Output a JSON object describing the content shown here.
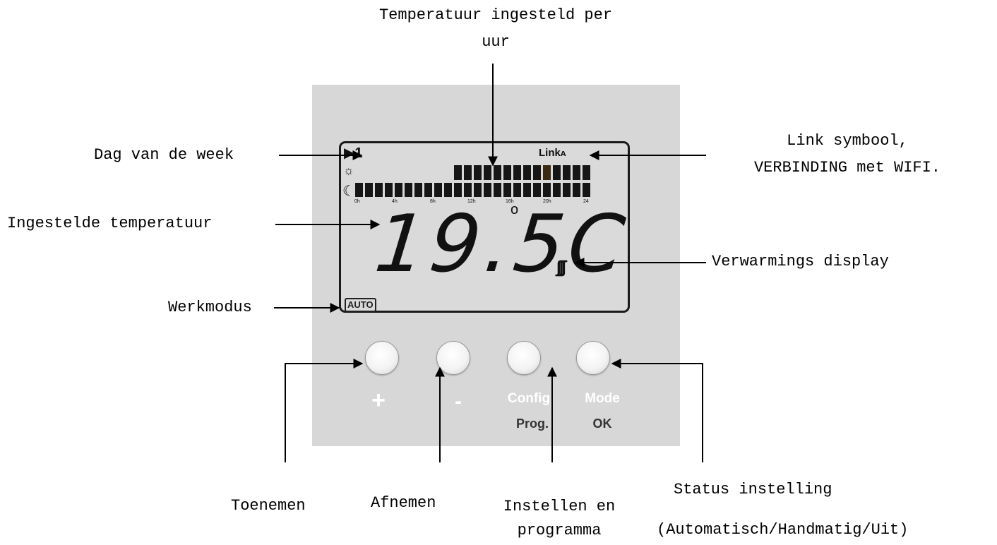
{
  "labels": {
    "top": [
      "Temperatuur ingesteld per",
      "uur"
    ],
    "day_of_week": "Dag van de week",
    "set_temperature": "Ingestelde temperatuur",
    "work_mode": "Werkmodus",
    "link_symbol": [
      "Link symbool,",
      "VERBINDING met WIFI."
    ],
    "heating_display": "Verwarmings display",
    "increase": "Toenemen",
    "decrease": "Afnemen",
    "setup_program": [
      "Instellen en",
      "programma"
    ],
    "status_setting": "Status instelling",
    "status_modes": "(Automatisch/Handmatig/Uit)"
  },
  "display": {
    "day": "1",
    "link": "Link",
    "temperature": "19.5C",
    "degree": "o",
    "mode_badge": "AUTO",
    "hour_ticks": [
      "0h",
      "4h",
      "8h",
      "12h",
      "16h",
      "20h",
      "24"
    ],
    "comfort_hours": [
      false,
      false,
      false,
      false,
      false,
      false,
      false,
      false,
      false,
      false,
      true,
      true,
      true,
      true,
      true,
      true,
      true,
      true,
      true,
      true,
      true,
      true,
      true,
      true
    ]
  },
  "buttons": {
    "plus": "+",
    "minus": "-",
    "config": "Config",
    "prog": "Prog.",
    "mode": "Mode",
    "ok": "OK"
  }
}
